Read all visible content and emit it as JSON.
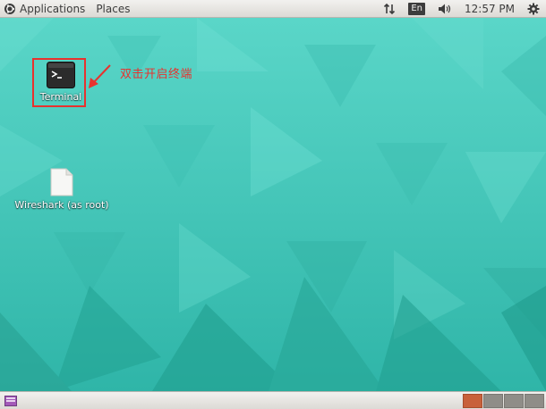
{
  "top_panel": {
    "menus": [
      {
        "label": "Applications"
      },
      {
        "label": "Places"
      }
    ],
    "tray": {
      "network_icon": "network-arrows-icon",
      "language": "En",
      "volume_icon": "volume-icon",
      "clock": "12:57 PM",
      "settings_icon": "gear-icon"
    }
  },
  "desktop": {
    "icons": [
      {
        "label": "Terminal",
        "icon": "terminal-icon"
      },
      {
        "label": "Wireshark (as root)",
        "icon": "file-icon"
      }
    ],
    "annotation": {
      "text": "双击开启终端",
      "color": "#e8322e"
    }
  },
  "bottom_panel": {
    "show_desktop_icon": "show-desktop-icon",
    "workspaces": [
      {
        "active": true
      },
      {
        "active": false
      },
      {
        "active": false
      },
      {
        "active": false
      }
    ]
  },
  "colors": {
    "desktop_base": "#49cdbf",
    "panel": "#dcdad5",
    "accent": "#c8613b"
  }
}
